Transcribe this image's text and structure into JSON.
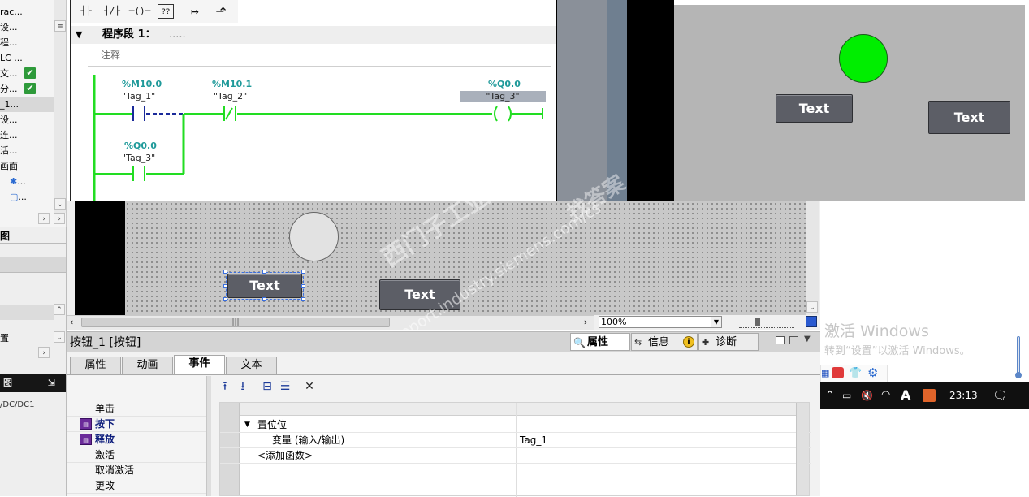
{
  "left_tree": {
    "rows": [
      {
        "label": "rac..."
      },
      {
        "label": "设..."
      },
      {
        "label": "程..."
      },
      {
        "label": "LC ..."
      },
      {
        "label": "文...",
        "checked": true
      },
      {
        "label": "分...",
        "checked": true
      },
      {
        "label": "_1...",
        "selected": true
      },
      {
        "label": "设..."
      },
      {
        "label": "连..."
      },
      {
        "label": "活..."
      },
      {
        "label": "画面"
      },
      {
        "label": "..."
      },
      {
        "label": "..."
      }
    ],
    "lower": {
      "heading": "图",
      "item_label": "置",
      "dark_label": "图",
      "footer_text": "/DC/DC1"
    }
  },
  "ladder": {
    "toolbar": [
      "┤├",
      "┤/├",
      "─()─",
      "??",
      "↦",
      "⬏"
    ],
    "network_title": "程序段 1：",
    "network_dots": ".....",
    "comment_placeholder": "注释",
    "contacts": [
      {
        "address": "%M10.0",
        "tag": "\"Tag_1\""
      },
      {
        "address": "%M10.1",
        "tag": "\"Tag_2\""
      },
      {
        "address": "%Q0.0",
        "tag": "\"Tag_3\""
      }
    ],
    "coil": {
      "address": "%Q0.0",
      "tag": "\"Tag_3\""
    }
  },
  "runtime": {
    "button1": "Text",
    "button2": "Text",
    "lamp_color": "#00ee00"
  },
  "screen_editor": {
    "button_selected": "Text",
    "button2": "Text",
    "zoom": "100%",
    "scroll_label": "|||"
  },
  "watermark": {
    "brand": "西门子工业",
    "site": "support.industry.siemens.com/cs",
    "site_tag": "找答案"
  },
  "inspector": {
    "title": "按钮_1 [按钮]",
    "top_tabs": [
      "属性",
      "信息",
      "诊断"
    ],
    "sub_tabs": [
      "属性",
      "动画",
      "事件",
      "文本"
    ],
    "events": [
      {
        "label": "单击"
      },
      {
        "label": "按下",
        "bold": true
      },
      {
        "label": "释放",
        "bold": true
      },
      {
        "label": "激活"
      },
      {
        "label": "取消激活"
      },
      {
        "label": "更改"
      }
    ],
    "func_toolbar": [
      "⭱",
      "⭳",
      "⊟",
      "☰",
      "✕"
    ],
    "func_rows": [
      {
        "label": "置位位",
        "value": ""
      },
      {
        "label": "变量 (输入/输出)",
        "value": "Tag_1"
      },
      {
        "label": "<添加函数>",
        "value": ""
      }
    ]
  },
  "windows": {
    "activate_title": "激活 Windows",
    "activate_sub": "转到“设置”以激活 Windows。",
    "time": "23:13",
    "ime_label": "A"
  }
}
